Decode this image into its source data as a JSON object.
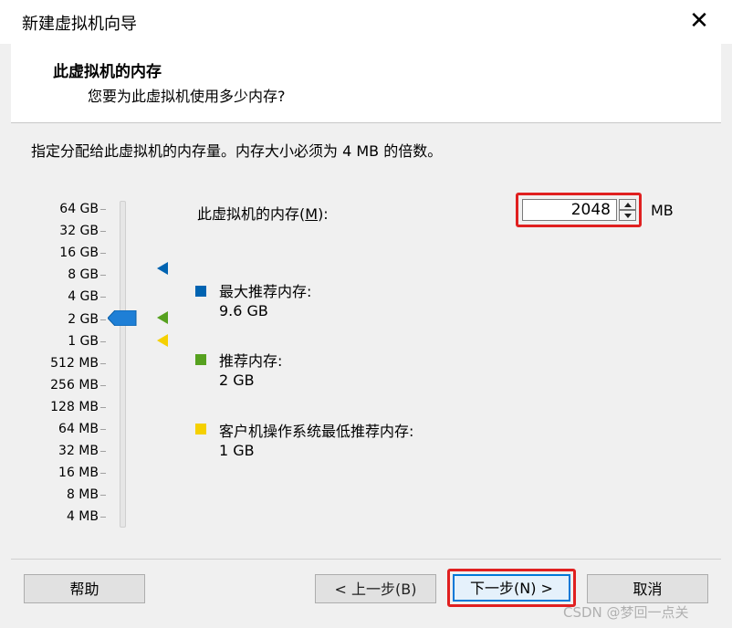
{
  "window": {
    "title": "新建虚拟机向导",
    "close_glyph": "✕"
  },
  "header": {
    "title": "此虚拟机的内存",
    "subtitle": "您要为此虚拟机使用多少内存?"
  },
  "instruction": "指定分配给此虚拟机的内存量。内存大小必须为 4 MB 的倍数。",
  "slider": {
    "labels": [
      "64 GB",
      "32 GB",
      "16 GB",
      "8 GB",
      "4 GB",
      "2 GB",
      "1 GB",
      "512 MB",
      "256 MB",
      "128 MB",
      "64 MB",
      "32 MB",
      "16 MB",
      "8 MB",
      "4 MB"
    ],
    "selected": "2 GB"
  },
  "memory": {
    "label_prefix": "此虚拟机的内存(",
    "label_key": "M",
    "label_suffix": "):",
    "value": "2048",
    "unit": "MB"
  },
  "legend": [
    {
      "title": "最大推荐内存:",
      "value": "9.6 GB",
      "color": "#0063b1"
    },
    {
      "title": "推荐内存:",
      "value": "2 GB",
      "color": "#56a11f"
    },
    {
      "title": "客户机操作系统最低推荐内存:",
      "value": "1 GB",
      "color": "#f5d000"
    }
  ],
  "buttons": {
    "help": "帮助",
    "back": "< 上一步(B)",
    "next": "下一步(N) >",
    "cancel": "取消"
  },
  "watermark": "CSDN @梦回一点关"
}
